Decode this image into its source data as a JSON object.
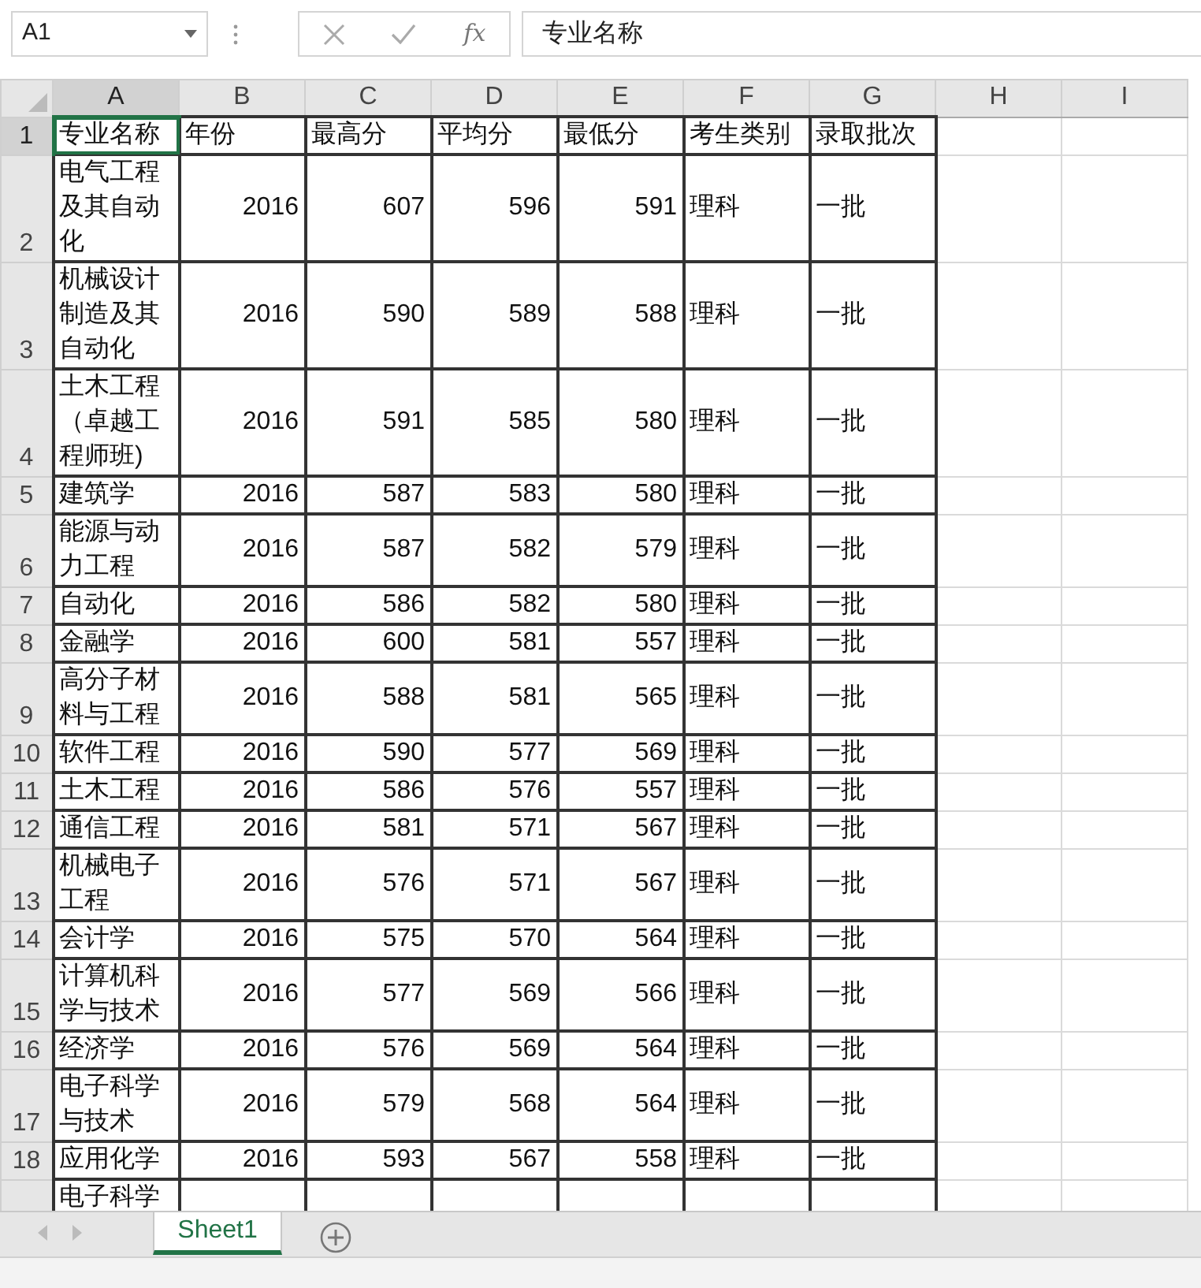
{
  "name_box": {
    "value": "A1"
  },
  "formula_bar": {
    "function_label": "fx",
    "value": "专业名称"
  },
  "columns": [
    {
      "letter": "A",
      "kind": "text",
      "selected": true
    },
    {
      "letter": "B",
      "kind": "number",
      "selected": false
    },
    {
      "letter": "C",
      "kind": "number",
      "selected": false
    },
    {
      "letter": "D",
      "kind": "number",
      "selected": false
    },
    {
      "letter": "E",
      "kind": "number",
      "selected": false
    },
    {
      "letter": "F",
      "kind": "text",
      "selected": false
    },
    {
      "letter": "G",
      "kind": "text",
      "selected": false
    },
    {
      "letter": "H",
      "selected": false
    },
    {
      "letter": "I",
      "selected": false
    }
  ],
  "rows": [
    {
      "number": "1",
      "selected": true,
      "kind": "header",
      "cells": [
        "专业名称",
        "年份",
        "最高分",
        "平均分",
        "最低分",
        "考生类别",
        "录取批次"
      ]
    },
    {
      "number": "2",
      "selected": false,
      "cells": [
        "电气工程及其自动化",
        "2016",
        "607",
        "596",
        "591",
        "理科",
        "一批"
      ]
    },
    {
      "number": "3",
      "selected": false,
      "cells": [
        "机械设计制造及其自动化",
        "2016",
        "590",
        "589",
        "588",
        "理科",
        "一批"
      ]
    },
    {
      "number": "4",
      "selected": false,
      "cells": [
        "土木工程（卓越工程师班)",
        "2016",
        "591",
        "585",
        "580",
        "理科",
        "一批"
      ]
    },
    {
      "number": "5",
      "selected": false,
      "cells": [
        "建筑学",
        "2016",
        "587",
        "583",
        "580",
        "理科",
        "一批"
      ]
    },
    {
      "number": "6",
      "selected": false,
      "cells": [
        "能源与动力工程",
        "2016",
        "587",
        "582",
        "579",
        "理科",
        "一批"
      ]
    },
    {
      "number": "7",
      "selected": false,
      "cells": [
        "自动化",
        "2016",
        "586",
        "582",
        "580",
        "理科",
        "一批"
      ]
    },
    {
      "number": "8",
      "selected": false,
      "cells": [
        "金融学",
        "2016",
        "600",
        "581",
        "557",
        "理科",
        "一批"
      ]
    },
    {
      "number": "9",
      "selected": false,
      "cells": [
        "高分子材料与工程",
        "2016",
        "588",
        "581",
        "565",
        "理科",
        "一批"
      ]
    },
    {
      "number": "10",
      "selected": false,
      "cells": [
        "软件工程",
        "2016",
        "590",
        "577",
        "569",
        "理科",
        "一批"
      ]
    },
    {
      "number": "11",
      "selected": false,
      "cells": [
        "土木工程",
        "2016",
        "586",
        "576",
        "557",
        "理科",
        "一批"
      ]
    },
    {
      "number": "12",
      "selected": false,
      "cells": [
        "通信工程",
        "2016",
        "581",
        "571",
        "567",
        "理科",
        "一批"
      ]
    },
    {
      "number": "13",
      "selected": false,
      "cells": [
        "机械电子工程",
        "2016",
        "576",
        "571",
        "567",
        "理科",
        "一批"
      ]
    },
    {
      "number": "14",
      "selected": false,
      "cells": [
        "会计学",
        "2016",
        "575",
        "570",
        "564",
        "理科",
        "一批"
      ]
    },
    {
      "number": "15",
      "selected": false,
      "cells": [
        "计算机科学与技术",
        "2016",
        "577",
        "569",
        "566",
        "理科",
        "一批"
      ]
    },
    {
      "number": "16",
      "selected": false,
      "cells": [
        "经济学",
        "2016",
        "576",
        "569",
        "564",
        "理科",
        "一批"
      ]
    },
    {
      "number": "17",
      "selected": false,
      "cells": [
        "电子科学与技术",
        "2016",
        "579",
        "568",
        "564",
        "理科",
        "一批"
      ]
    },
    {
      "number": "18",
      "selected": false,
      "cells": [
        "应用化学",
        "2016",
        "593",
        "567",
        "558",
        "理科",
        "一批"
      ]
    },
    {
      "selected": false,
      "cells": [
        "电子科学"
      ]
    }
  ],
  "sheet_tabs": [
    {
      "label": "Sheet1",
      "selected": true
    }
  ]
}
